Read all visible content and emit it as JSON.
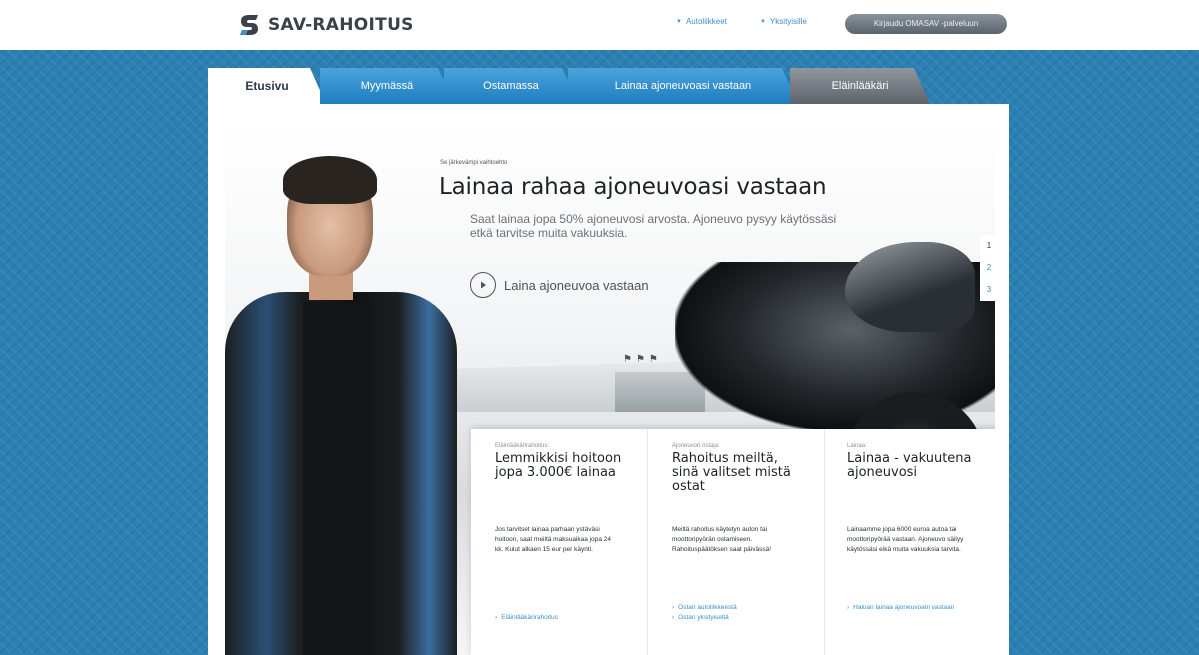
{
  "header": {
    "logo_text": "SAV-RAHOITUS",
    "links": [
      {
        "label": "Autoliikkeet"
      },
      {
        "label": "Yksityisille"
      }
    ],
    "login_button": "Kirjaudu OMASAV -palveluun"
  },
  "tabs": [
    {
      "label": "Etusivu",
      "state": "active"
    },
    {
      "label": "Myymässä",
      "state": "normal"
    },
    {
      "label": "Ostamassa",
      "state": "normal"
    },
    {
      "label": "Lainaa ajoneuvoasi vastaan",
      "state": "normal"
    },
    {
      "label": "Eläinlääkäri",
      "state": "alt"
    }
  ],
  "hero": {
    "eyebrow": "Se järkevämpi vaihtoehto",
    "headline": "Lainaa rahaa ajoneuvoasi vastaan",
    "subtext": "Saat lainaa jopa 50% ajoneuvosi arvosta. Ajoneuvo pysyy käytössäsi etkä tarvitse muita vakuuksia.",
    "cta": "Laina ajoneuvoa vastaan",
    "pager": [
      "1",
      "2",
      "3"
    ]
  },
  "boxes": [
    {
      "label": "Eläinlääkärirahoitus:",
      "title": "Lemmikkisi hoitoon jopa 3.000€ lainaa",
      "text": "Jos tarvitset lainaa parhaan ystäväsi hoitoon, saat meiltä maksuaikaa jopa 24 kk. Kulut alkaen 15 eur per käynti.",
      "links": [
        "Eläinlääkärirahoitus"
      ]
    },
    {
      "label": "Ajoneuvon ostaja:",
      "title": "Rahoitus meiltä, sinä valitset mistä ostat",
      "text": "Meiltä rahoitus käytetyn auton tai moottoripyörän ostamiseen. Rahoituspäätöksen saat päivässä!",
      "links": [
        "Ostan autoliikkeestä",
        "Ostan yksityiseltä"
      ]
    },
    {
      "label": "Lainaa:",
      "title": "Lainaa - vakuutena ajoneuvosi",
      "text": "Lainaamme jopa 6000 euroa autoa tai moottoripyörää vastaan. Ajoneuvo säilyy käytössäsi eikä muita vakuuksia tarvita.",
      "links": [
        "Haluan lainaa ajoneuvoani vastaan"
      ]
    }
  ],
  "colors": {
    "brand_blue": "#2a7fb3",
    "link_blue": "#3f8fc9",
    "tab_blue": "#1f7dbd",
    "tab_grey": "#5d656c"
  }
}
